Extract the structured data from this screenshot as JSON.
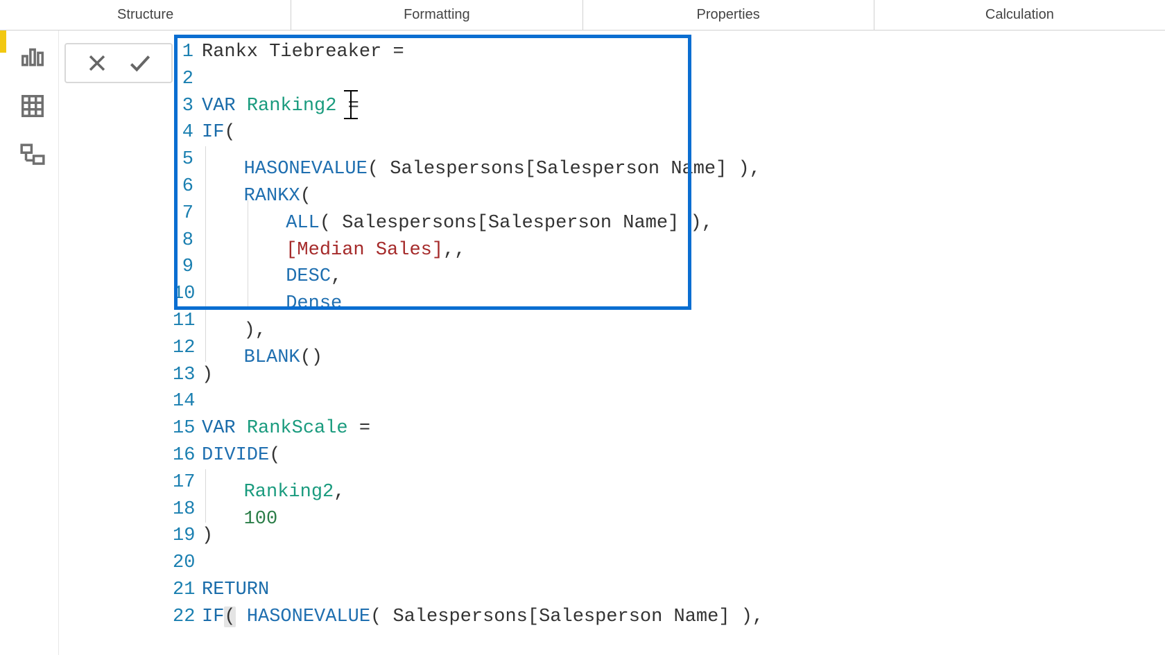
{
  "ribbon": {
    "tabs": [
      "Structure",
      "Formatting",
      "Properties",
      "Calculation"
    ]
  },
  "code": {
    "lines": [
      {
        "n": "1",
        "tokens": [
          [
            "txt",
            "Rankx Tiebreaker = "
          ]
        ]
      },
      {
        "n": "2",
        "tokens": [
          [
            "txt",
            ""
          ]
        ]
      },
      {
        "n": "3",
        "tokens": [
          [
            "kw",
            "VAR"
          ],
          [
            "txt",
            " "
          ],
          [
            "var",
            "Ranking2"
          ],
          [
            "txt",
            " = "
          ]
        ]
      },
      {
        "n": "4",
        "tokens": [
          [
            "kw",
            "IF"
          ],
          [
            "txt",
            "("
          ]
        ]
      },
      {
        "n": "5",
        "tokens": [
          [
            "guide",
            ""
          ],
          [
            "txt",
            "   "
          ],
          [
            "fn",
            "HASONEVALUE"
          ],
          [
            "txt",
            "( Salespersons[Salesperson Name] ),"
          ]
        ]
      },
      {
        "n": "6",
        "tokens": [
          [
            "guide",
            ""
          ],
          [
            "txt",
            "   "
          ],
          [
            "fn",
            "RANKX"
          ],
          [
            "txt",
            "("
          ]
        ]
      },
      {
        "n": "7",
        "tokens": [
          [
            "guide",
            ""
          ],
          [
            "txt",
            "   "
          ],
          [
            "guide",
            ""
          ],
          [
            "txt",
            "   "
          ],
          [
            "fn",
            "ALL"
          ],
          [
            "txt",
            "( Salespersons[Salesperson Name] ),"
          ]
        ]
      },
      {
        "n": "8",
        "tokens": [
          [
            "guide",
            ""
          ],
          [
            "txt",
            "   "
          ],
          [
            "guide",
            ""
          ],
          [
            "txt",
            "   "
          ],
          [
            "meas",
            "[Median Sales]"
          ],
          [
            "txt",
            ",,"
          ]
        ]
      },
      {
        "n": "9",
        "tokens": [
          [
            "guide",
            ""
          ],
          [
            "txt",
            "   "
          ],
          [
            "guide",
            ""
          ],
          [
            "txt",
            "   "
          ],
          [
            "fn",
            "DESC"
          ],
          [
            "txt",
            ","
          ]
        ]
      },
      {
        "n": "10",
        "tokens": [
          [
            "guide",
            ""
          ],
          [
            "txt",
            "   "
          ],
          [
            "guide",
            ""
          ],
          [
            "txt",
            "   "
          ],
          [
            "fn",
            "Dense"
          ]
        ]
      },
      {
        "n": "11",
        "tokens": [
          [
            "guide",
            ""
          ],
          [
            "txt",
            "   ),"
          ]
        ]
      },
      {
        "n": "12",
        "tokens": [
          [
            "guide",
            ""
          ],
          [
            "txt",
            "   "
          ],
          [
            "fn",
            "BLANK"
          ],
          [
            "txt",
            "()"
          ]
        ]
      },
      {
        "n": "13",
        "tokens": [
          [
            "txt",
            ")"
          ]
        ]
      },
      {
        "n": "14",
        "tokens": [
          [
            "txt",
            ""
          ]
        ]
      },
      {
        "n": "15",
        "tokens": [
          [
            "kw",
            "VAR"
          ],
          [
            "txt",
            " "
          ],
          [
            "var",
            "RankScale"
          ],
          [
            "txt",
            " ="
          ]
        ]
      },
      {
        "n": "16",
        "tokens": [
          [
            "fn",
            "DIVIDE"
          ],
          [
            "txt",
            "("
          ]
        ]
      },
      {
        "n": "17",
        "tokens": [
          [
            "guide",
            ""
          ],
          [
            "txt",
            "   "
          ],
          [
            "var",
            "Ranking2"
          ],
          [
            "txt",
            ","
          ]
        ]
      },
      {
        "n": "18",
        "tokens": [
          [
            "guide",
            ""
          ],
          [
            "txt",
            "   "
          ],
          [
            "num",
            "100"
          ]
        ]
      },
      {
        "n": "19",
        "tokens": [
          [
            "txt",
            ")"
          ]
        ]
      },
      {
        "n": "20",
        "tokens": [
          [
            "txt",
            ""
          ]
        ]
      },
      {
        "n": "21",
        "tokens": [
          [
            "kw",
            "RETURN"
          ]
        ]
      },
      {
        "n": "22",
        "tokens": [
          [
            "kw",
            "IF"
          ],
          [
            "brhl",
            "("
          ],
          [
            "txt",
            " "
          ],
          [
            "fn",
            "HASONEVALUE"
          ],
          [
            "txt",
            "( Salespersons[Salesperson Name] ),"
          ]
        ]
      }
    ]
  }
}
